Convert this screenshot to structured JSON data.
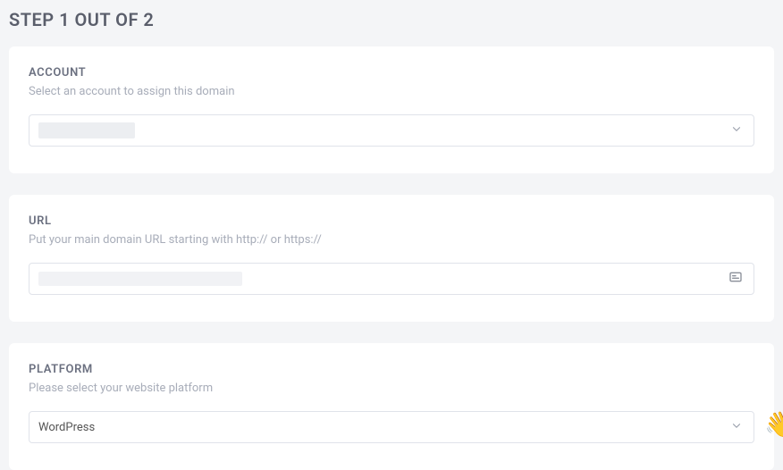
{
  "header": {
    "title": "STEP 1 OUT OF 2"
  },
  "account": {
    "label": "ACCOUNT",
    "description": "Select an account to assign this domain",
    "selected_value": ""
  },
  "url": {
    "label": "URL",
    "description": "Put your main domain URL starting with http:// or https://",
    "value": ""
  },
  "platform": {
    "label": "PLATFORM",
    "description": "Please select your website platform",
    "selected_value": "WordPress"
  },
  "widget": {
    "emoji": "👋"
  }
}
